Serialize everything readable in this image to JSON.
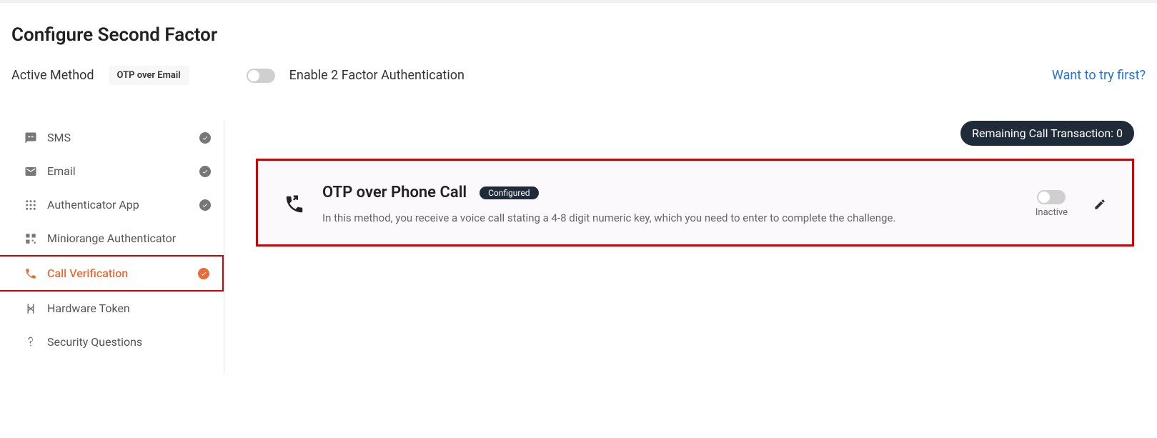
{
  "page": {
    "title": "Configure Second Factor"
  },
  "header": {
    "active_method_label": "Active Method",
    "active_method_value": "OTP over Email",
    "enable_label": "Enable 2 Factor Authentication",
    "link_text": "Want to try first?"
  },
  "sidebar": {
    "items": [
      {
        "label": "SMS",
        "checked": true,
        "active": false
      },
      {
        "label": "Email",
        "checked": true,
        "active": false
      },
      {
        "label": "Authenticator App",
        "checked": true,
        "active": false
      },
      {
        "label": "Miniorange Authenticator",
        "checked": false,
        "active": false
      },
      {
        "label": "Call Verification",
        "checked": true,
        "active": true
      },
      {
        "label": "Hardware Token",
        "checked": false,
        "active": false
      },
      {
        "label": "Security Questions",
        "checked": false,
        "active": false
      }
    ]
  },
  "main": {
    "remaining_label": "Remaining Call Transaction: 0",
    "method": {
      "title": "OTP over Phone Call",
      "configured_badge": "Configured",
      "description": "In this method, you receive a voice call stating a 4-8 digit numeric key, which you need to enter to complete the challenge.",
      "status": "Inactive"
    }
  }
}
